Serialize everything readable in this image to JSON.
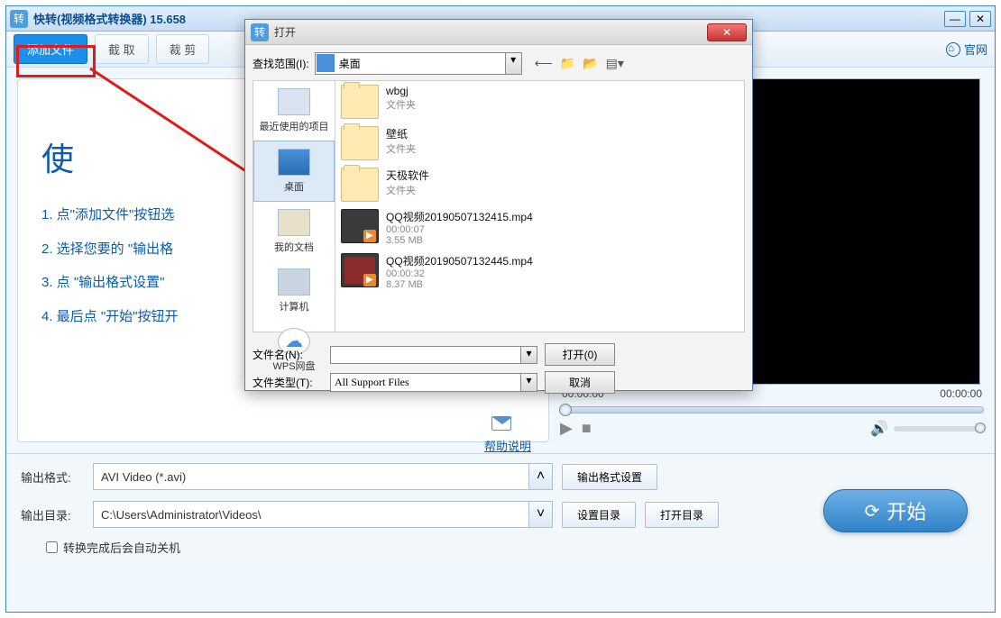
{
  "window": {
    "title": "快转(视频格式转换器) 15.658",
    "icon_text": "转"
  },
  "toolbar": {
    "add_file": "添加文件",
    "capture": "截 取",
    "cut": "裁 剪",
    "official_site": "官网"
  },
  "guide": {
    "heading": "使",
    "step1": "1. 点\"添加文件\"按钮选",
    "step2": "2. 选择您要的 \"输出格",
    "step3": "3. 点 \"输出格式设置\"",
    "step4": "4. 最后点 \"开始\"按钮开",
    "help_link": "帮助说明"
  },
  "player": {
    "time_start": "00:00:00",
    "time_end": "00:00:00"
  },
  "output": {
    "format_label": "输出格式:",
    "format_value": "AVI Video (*.avi)",
    "format_settings_btn": "输出格式设置",
    "dir_label": "输出目录:",
    "dir_value": "C:\\Users\\Administrator\\Videos\\",
    "set_dir_btn": "设置目录",
    "open_dir_btn": "打开目录",
    "start_btn": "开始",
    "autoclose": "转换完成后会自动关机"
  },
  "dialog": {
    "title": "打开",
    "range_label": "查找范围(I):",
    "range_value": "桌面",
    "sidebar": {
      "recent": "最近使用的项目",
      "desktop": "桌面",
      "docs": "我的文档",
      "computer": "计算机",
      "wps": "WPS网盘"
    },
    "files": [
      {
        "name": "wbgj",
        "type": "文件夹"
      },
      {
        "name": "壁纸",
        "type": "文件夹"
      },
      {
        "name": "天极软件",
        "type": "文件夹"
      },
      {
        "name": "QQ视频20190507132415.mp4",
        "duration": "00:00:07",
        "size": "3.55 MB"
      },
      {
        "name": "QQ视频20190507132445.mp4",
        "duration": "00:00:32",
        "size": "8.37 MB"
      }
    ],
    "filename_label": "文件名(N):",
    "filename_value": "",
    "filetype_label": "文件类型(T):",
    "filetype_value": "All Support Files",
    "open_btn": "打开(0)",
    "cancel_btn": "取消"
  }
}
